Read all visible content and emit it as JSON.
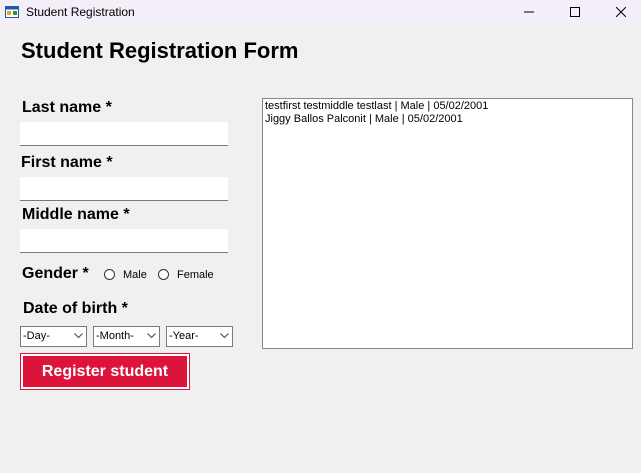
{
  "window": {
    "title": "Student Registration"
  },
  "form": {
    "heading": "Student Registration Form",
    "last_name_label": "Last name *",
    "first_name_label": "First name *",
    "middle_name_label": "Middle name *",
    "last_name_value": "",
    "first_name_value": "",
    "middle_name_value": "",
    "gender_label": "Gender *",
    "gender_options": [
      "Male",
      "Female"
    ],
    "dob_label": "Date of birth *",
    "day_value": "-Day-",
    "month_value": "-Month-",
    "year_value": "-Year-",
    "register_label": "Register student"
  },
  "colors": {
    "accent": "#dc143c",
    "titlebar": "#f3eef8",
    "background": "#f0f0f0"
  },
  "students": [
    "testfirst testmiddle testlast | Male | 05/02/2001",
    "Jiggy Ballos Palconit | Male | 05/02/2001"
  ]
}
